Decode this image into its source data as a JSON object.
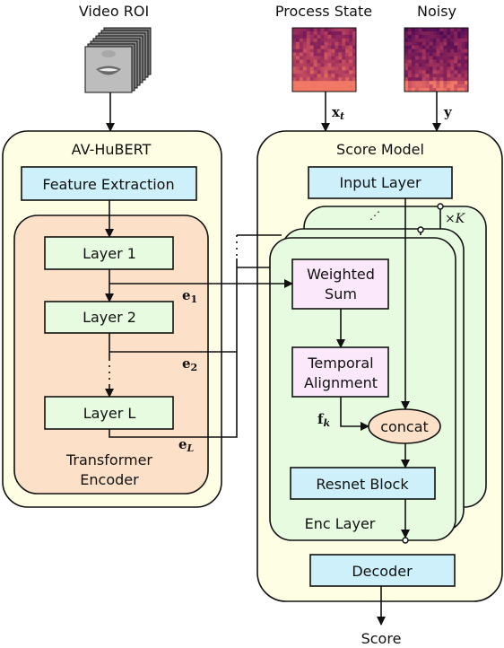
{
  "inputs": {
    "video_label": "Video ROI",
    "process_state_label": "Process State",
    "noisy_label": "Noisy",
    "xt_label": "x",
    "xt_sub": "t",
    "y_label": "y"
  },
  "av_hubert": {
    "title": "AV-HuBERT",
    "feature_extraction": "Feature Extraction",
    "layers": [
      "Layer 1",
      "Layer 2",
      "Layer L"
    ],
    "encoder_label_line1": "Transformer",
    "encoder_label_line2": "Encoder",
    "embeddings": [
      {
        "base": "e",
        "sub": "1"
      },
      {
        "base": "e",
        "sub": "2"
      },
      {
        "base": "e",
        "sub": "L"
      }
    ]
  },
  "score_model": {
    "title": "Score Model",
    "input_layer": "Input Layer",
    "repeat_label": "×K",
    "weighted_sum_line1": "Weighted",
    "weighted_sum_line2": "Sum",
    "temporal_line1": "Temporal",
    "temporal_line2": "Alignment",
    "fk_base": "f",
    "fk_sub": "k",
    "concat": "concat",
    "resnet_block": "Resnet Block",
    "enc_layer": "Enc Layer",
    "decoder": "Decoder"
  },
  "output_label": "Score",
  "colors": {
    "module_bg": "#fefee4",
    "encoder_bg": "#fde0c8",
    "layer_bg": "#e6fbdf",
    "block_bg": "#cdf0fb",
    "attention_bg": "#fbe8fb"
  }
}
